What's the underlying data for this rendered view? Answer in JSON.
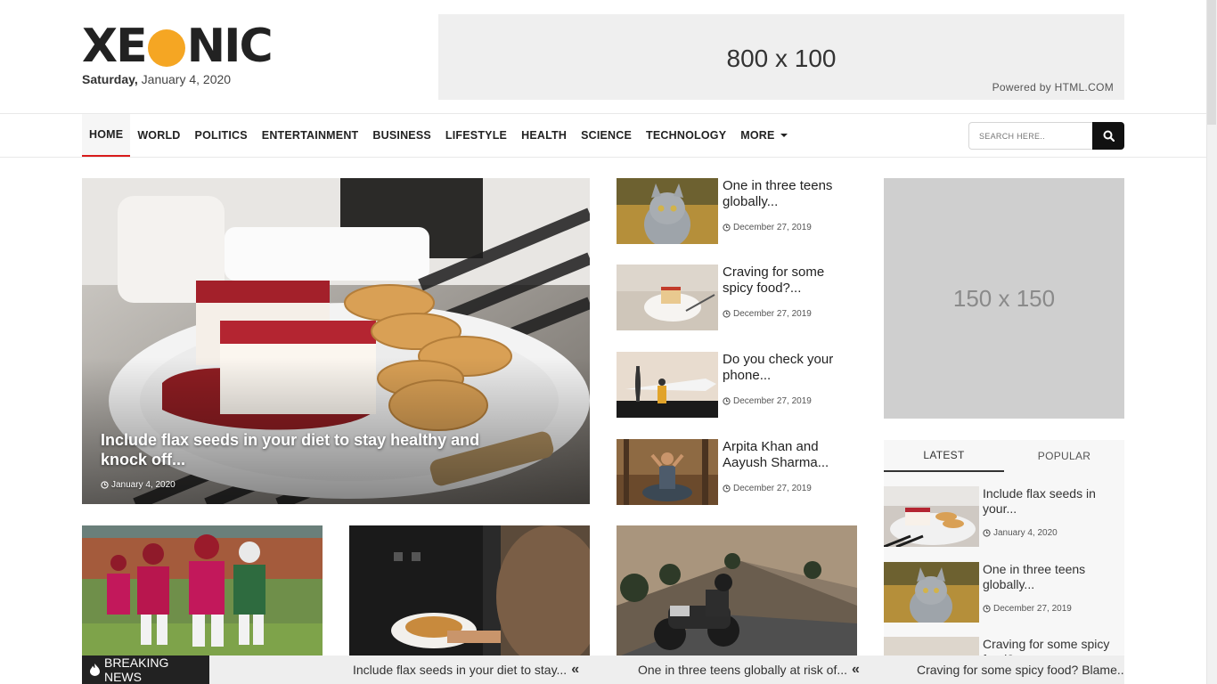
{
  "brand": {
    "logo_text_left": "XE",
    "logo_text_right": "NIC",
    "accent_color": "#f5a623"
  },
  "date": {
    "weekday": "Saturday,",
    "rest": "January 4, 2020"
  },
  "header_ad": {
    "size_text": "800 x 100",
    "powered_text": "Powered by HTML.COM"
  },
  "nav": {
    "items": [
      "HOME",
      "WORLD",
      "POLITICS",
      "ENTERTAINMENT",
      "BUSINESS",
      "LIFESTYLE",
      "HEALTH",
      "SCIENCE",
      "TECHNOLOGY",
      "MORE"
    ],
    "active": "HOME",
    "active_color": "#d81b1b"
  },
  "search": {
    "placeholder": "SEARCH HERE..",
    "icon": "search-icon"
  },
  "hero": {
    "title": "Include flax seeds in your diet to stay healthy and knock off...",
    "date": "January 4, 2020"
  },
  "side_posts": [
    {
      "title": "One in three teens globally...",
      "date": "December 27, 2019",
      "thumb": "kitten"
    },
    {
      "title": "Craving for some spicy food?...",
      "date": "December 27, 2019",
      "thumb": "cake-plate"
    },
    {
      "title": "Do you check your phone...",
      "date": "December 27, 2019",
      "thumb": "airplane"
    },
    {
      "title": "Arpita Khan and Aayush Sharma...",
      "date": "December 27, 2019",
      "thumb": "meditation"
    }
  ],
  "square_ad": {
    "size_text": "150 x 150"
  },
  "tabs_widget": {
    "tabs": [
      "LATEST",
      "POPULAR"
    ],
    "active": "LATEST",
    "items": [
      {
        "title": "Include flax seeds in your...",
        "date": "January 4, 2020",
        "thumb": "dessert"
      },
      {
        "title": "One in three teens globally...",
        "date": "December 27, 2019",
        "thumb": "kitten"
      },
      {
        "title": "Craving for some spicy food?...",
        "date": "",
        "thumb": "cake-plate"
      }
    ]
  },
  "cards": [
    {
      "thumb": "football"
    },
    {
      "thumb": "waffle"
    },
    {
      "thumb": "motorcycle"
    }
  ],
  "breaking": {
    "label": "BREAKING NEWS",
    "items": [
      "Include flax seeds in your diet to stay...",
      "One in three teens globally at risk of...",
      "Craving for some spicy food? Blame..."
    ]
  }
}
